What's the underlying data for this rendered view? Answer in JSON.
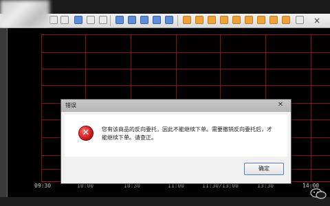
{
  "toolbar": {
    "icons": [
      "window-icon",
      "grid-icon",
      "chart-icon",
      "print-icon",
      "orange-tool-icon"
    ],
    "close_glyph": "×"
  },
  "chart": {
    "time_labels": [
      "09:30",
      "10:00",
      "10:30",
      "11:00",
      "11:30/13:00",
      "13:30",
      "14:00"
    ],
    "grid_color": "#8a1020",
    "background": "#000000"
  },
  "dialog": {
    "title": "错误",
    "close_glyph": "✕",
    "message_line1": "您有该商品的反向委托，因此不能继续下单。需要撤销反向委托后，才",
    "message_line2": "能继续下单。请查正。",
    "ok_label": "确定",
    "icon": "error-icon"
  }
}
